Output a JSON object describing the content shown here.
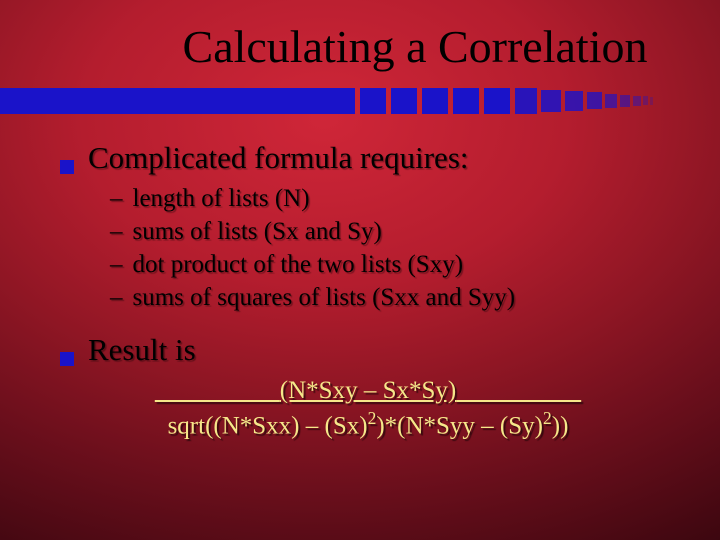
{
  "title": "Calculating a Correlation",
  "bullets": [
    {
      "text": "Complicated formula requires:",
      "sub": [
        "length of lists (N)",
        "sums of lists (Sx and Sy)",
        "dot product of the two lists (Sxy)",
        "sums of squares of lists (Sxx and Syy)"
      ]
    },
    {
      "text": "Result is",
      "sub": []
    }
  ],
  "formula": {
    "numerator": "(N*Sxy – Sx*Sy)",
    "den_a": "sqrt((N*Sxx) – (Sx)",
    "den_b": ")*(N*Syy – (Sy)",
    "den_c": "))",
    "sup": "2"
  },
  "colors": {
    "accent": "#1a13c9",
    "formula": "#f6e78a"
  }
}
